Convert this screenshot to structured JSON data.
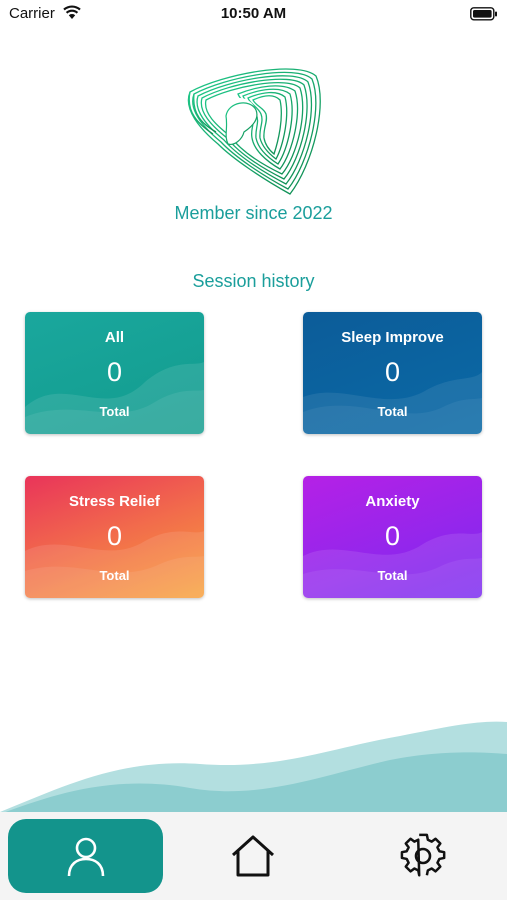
{
  "status_bar": {
    "carrier": "Carrier",
    "time": "10:50 AM"
  },
  "profile": {
    "member_since": "Member since 2022"
  },
  "sessions": {
    "title": "Session history",
    "cards": [
      {
        "name": "All",
        "value": "0",
        "total_label": "Total"
      },
      {
        "name": "Sleep Improve",
        "value": "0",
        "total_label": "Total"
      },
      {
        "name": "Stress Relief",
        "value": "0",
        "total_label": "Total"
      },
      {
        "name": "Anxiety",
        "value": "0",
        "total_label": "Total"
      }
    ]
  },
  "tab_bar": {
    "active_tab": "profile",
    "tabs": [
      {
        "id": "profile",
        "icon": "user-icon"
      },
      {
        "id": "home",
        "icon": "home-icon"
      },
      {
        "id": "settings",
        "icon": "gear-icon"
      }
    ]
  },
  "colors": {
    "accent": "#1a9e9b",
    "active_tab": "#13948c",
    "card_all": "#129c8e",
    "card_sleep": "#0b629f",
    "card_stress": "#f26d4b",
    "card_anxiety": "#8e27ee"
  }
}
